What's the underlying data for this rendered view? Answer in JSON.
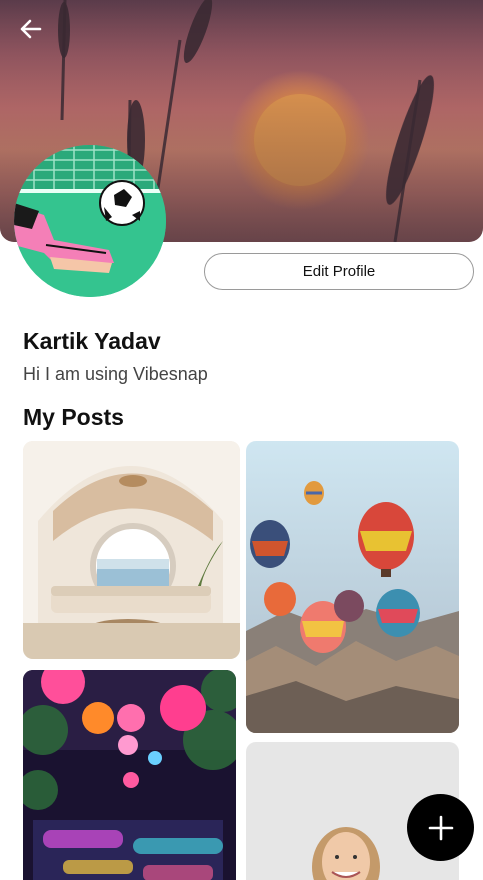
{
  "profile": {
    "name": "Kartik Yadav",
    "bio": "Hi I am using Vibesnap",
    "edit_label": "Edit Profile"
  },
  "posts_section": {
    "title": "My Posts",
    "posts": [
      {
        "subject": "arched living room with round window"
      },
      {
        "subject": "hot air balloons over valley"
      },
      {
        "subject": "neon lanterns lounge"
      },
      {
        "subject": "smiling woman portrait"
      }
    ]
  },
  "icons": {
    "back": "arrow-left-icon",
    "add": "plus-icon"
  },
  "colors": {
    "fab": "#000000",
    "avatar_bg": "#34c48f"
  }
}
